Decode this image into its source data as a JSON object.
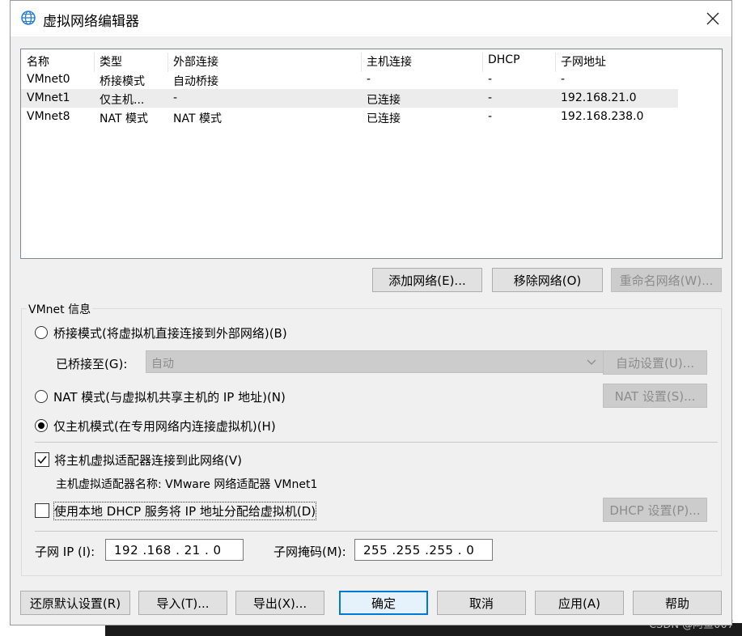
{
  "window": {
    "title": "虚拟网络编辑器"
  },
  "table": {
    "headers": [
      "名称",
      "类型",
      "外部连接",
      "主机连接",
      "DHCP",
      "子网地址"
    ],
    "rows": [
      [
        "VMnet0",
        "桥接模式",
        "自动桥接",
        "-",
        "-",
        "-"
      ],
      [
        "VMnet1",
        "仅主机...",
        "-",
        "已连接",
        "-",
        "192.168.21.0"
      ],
      [
        "VMnet8",
        "NAT 模式",
        "NAT 模式",
        "已连接",
        "-",
        "192.168.238.0"
      ]
    ],
    "selected_row": 1
  },
  "table_buttons": {
    "add": "添加网络(E)...",
    "remove": "移除网络(O)",
    "rename": "重命名网络(W)..."
  },
  "vmnet_info": {
    "group_label": "VMnet 信息",
    "bridged_radio": "桥接模式(将虚拟机直接连接到外部网络)(B)",
    "bridged_to_label": "已桥接至(G):",
    "bridged_to_value": "自动",
    "auto_settings": "自动设置(U)...",
    "nat_radio": "NAT 模式(与虚拟机共享主机的 IP 地址)(N)",
    "nat_settings": "NAT 设置(S)...",
    "hostonly_radio": "仅主机模式(在专用网络内连接虚拟机)(H)",
    "selected_mode": "hostonly",
    "connect_adapter_check": "将主机虚拟适配器连接到此网络(V)",
    "connect_adapter_checked": true,
    "adapter_name": "主机虚拟适配器名称: VMware 网络适配器 VMnet1",
    "dhcp_check": "使用本地 DHCP 服务将 IP 地址分配给虚拟机(D)",
    "dhcp_checked": false,
    "dhcp_settings": "DHCP 设置(P)...",
    "subnet_ip_label": "子网 IP (I):",
    "subnet_ip_value": "192 .168 . 21  .  0",
    "subnet_mask_label": "子网掩码(M):",
    "subnet_mask_value": "255 .255 .255 .  0"
  },
  "footer": {
    "restore": "还原默认设置(R)",
    "import": "导入(T)...",
    "export": "导出(X)...",
    "ok": "确定",
    "cancel": "取消",
    "apply": "应用(A)",
    "help": "帮助"
  },
  "watermark": "CSDN @阿鱼007",
  "colors": {
    "dialog_bg": "#f0f0f0",
    "accent": "#0078d7",
    "selected_row": "#ececec"
  },
  "icons": {
    "title": "globe-network-icon",
    "close": "close-icon",
    "combo": "chevron-down-icon"
  }
}
